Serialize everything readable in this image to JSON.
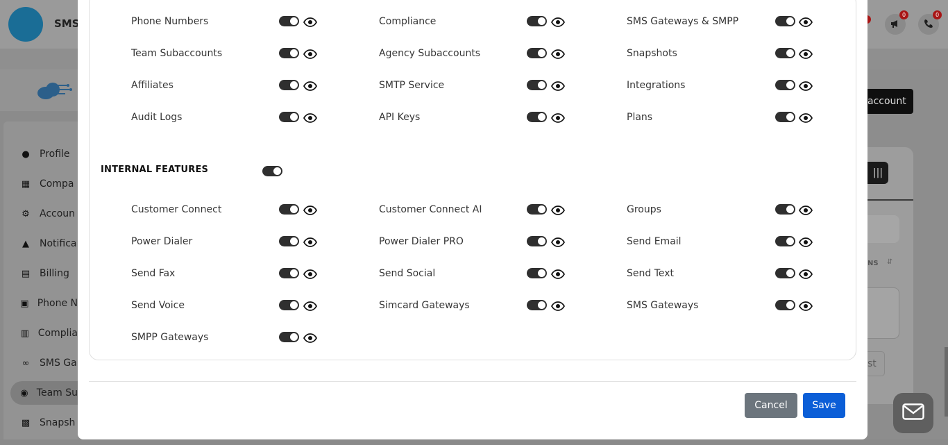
{
  "background": {
    "app_name": "SMS-",
    "top_icons": [
      {
        "icon": "megaphone-icon",
        "badge": "0"
      },
      {
        "icon": "phone-icon",
        "badge": "0"
      }
    ],
    "nav_items": [
      {
        "label": "Profile",
        "icon": "user-icon"
      },
      {
        "label": "Compa",
        "icon": "building-icon"
      },
      {
        "label": "Accoun",
        "icon": "gear-icon"
      },
      {
        "label": "Notifica",
        "icon": "bell-icon"
      },
      {
        "label": "Billing",
        "icon": "receipt-icon"
      },
      {
        "label": "Phone N",
        "icon": "id-card-icon"
      },
      {
        "label": "Complia",
        "icon": "clipboard-icon"
      },
      {
        "label": "SMS Ga",
        "icon": "gateway-icon"
      },
      {
        "label": "Team Su",
        "icon": "users-icon",
        "active": true
      },
      {
        "label": "Snapsh",
        "icon": "camera-icon"
      }
    ],
    "add_button_label": "account",
    "column_label": "NS",
    "next_button_label": "st"
  },
  "modal": {
    "top_features": [
      [
        {
          "label": "Phone Numbers",
          "enabled": true
        },
        {
          "label": "Compliance",
          "enabled": true
        },
        {
          "label": "SMS Gateways & SMPP",
          "enabled": true
        }
      ],
      [
        {
          "label": "Team Subaccounts",
          "enabled": true
        },
        {
          "label": "Agency Subaccounts",
          "enabled": true
        },
        {
          "label": "Snapshots",
          "enabled": true
        }
      ],
      [
        {
          "label": "Affiliates",
          "enabled": true
        },
        {
          "label": "SMTP Service",
          "enabled": true
        },
        {
          "label": "Integrations",
          "enabled": true
        }
      ],
      [
        {
          "label": "Audit Logs",
          "enabled": true
        },
        {
          "label": "API Keys",
          "enabled": true
        },
        {
          "label": "Plans",
          "enabled": true
        }
      ]
    ],
    "internal_section": {
      "title": "INTERNAL FEATURES",
      "enabled": true
    },
    "internal_features": [
      [
        {
          "label": "Customer Connect",
          "enabled": true
        },
        {
          "label": "Customer Connect AI",
          "enabled": true
        },
        {
          "label": "Groups",
          "enabled": true
        }
      ],
      [
        {
          "label": "Power Dialer",
          "enabled": true
        },
        {
          "label": "Power Dialer PRO",
          "enabled": true
        },
        {
          "label": "Send Email",
          "enabled": true
        }
      ],
      [
        {
          "label": "Send Fax",
          "enabled": true
        },
        {
          "label": "Send Social",
          "enabled": true
        },
        {
          "label": "Send Text",
          "enabled": true
        }
      ],
      [
        {
          "label": "Send Voice",
          "enabled": true
        },
        {
          "label": "Simcard Gateways",
          "enabled": true
        },
        {
          "label": "SMS Gateways",
          "enabled": true
        }
      ],
      [
        {
          "label": "SMPP Gateways",
          "enabled": true
        }
      ]
    ],
    "cancel_label": "Cancel",
    "save_label": "Save"
  },
  "colors": {
    "save": "#0b5ed7",
    "cancel": "#6c757d",
    "toggle_on": "#2f2f2f"
  }
}
